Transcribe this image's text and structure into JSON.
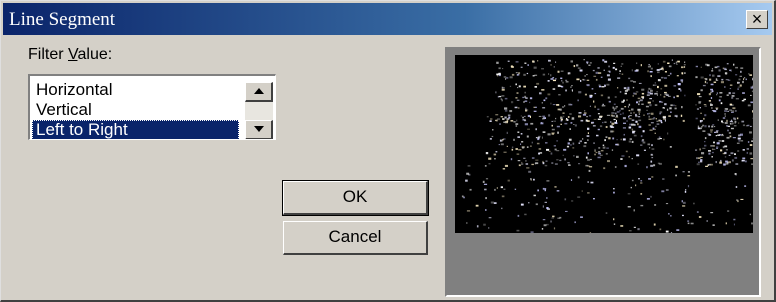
{
  "window": {
    "title": "Line Segment",
    "close_label": "×"
  },
  "filter": {
    "label_prefix": "Filter ",
    "label_accel": "V",
    "label_suffix": "alue:",
    "options": [
      "Horizontal",
      "Vertical",
      "Left to Right"
    ],
    "selected": "Left to Right"
  },
  "buttons": {
    "ok_label": "OK",
    "cancel_label": "Cancel"
  },
  "preview": {
    "icon": "edge-detected-image-preview"
  },
  "colors": {
    "titlebar_start": "#0a246a",
    "titlebar_end": "#a6caf0",
    "dialog_bg": "#d4d0c8",
    "selection": "#0a246a",
    "preview_bg": "#000000"
  }
}
